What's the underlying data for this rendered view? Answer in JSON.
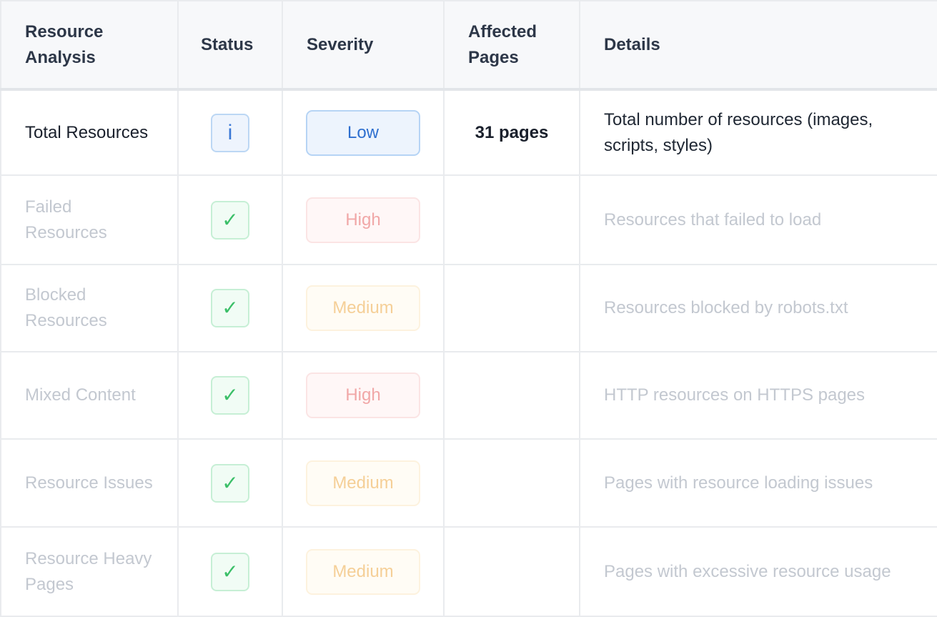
{
  "headers": {
    "resource_analysis": "Resource Analysis",
    "status": "Status",
    "severity": "Severity",
    "affected_pages": "Affected Pages",
    "details": "Details"
  },
  "rows": [
    {
      "metric": "Total Resources",
      "status": "i",
      "status_icon": "info-icon",
      "severity": "Low",
      "affected": "31 pages",
      "details": "Total number of resources (images, scripts, styles)"
    },
    {
      "metric": "Failed Resources",
      "status": "✓",
      "status_icon": "check-icon",
      "severity": "High",
      "affected": "",
      "details": "Resources that failed to load"
    },
    {
      "metric": "Blocked Resources",
      "status": "✓",
      "status_icon": "check-icon",
      "severity": "Medium",
      "affected": "",
      "details": "Resources blocked by robots.txt"
    },
    {
      "metric": "Mixed Content",
      "status": "✓",
      "status_icon": "check-icon",
      "severity": "High",
      "affected": "",
      "details": "HTTP resources on HTTPS pages"
    },
    {
      "metric": "Resource Issues",
      "status": "✓",
      "status_icon": "check-icon",
      "severity": "Medium",
      "affected": "",
      "details": "Pages with resource loading issues"
    },
    {
      "metric": "Resource Heavy Pages",
      "status": "✓",
      "status_icon": "check-icon",
      "severity": "Medium",
      "affected": "",
      "details": "Pages with excessive resource usage"
    }
  ],
  "colors": {
    "info_accent": "#3a78d6",
    "ok_accent": "#3bbf68",
    "high_accent": "#f1a7a7",
    "medium_accent": "#f5cf97",
    "low_accent": "#2e6fcf"
  }
}
